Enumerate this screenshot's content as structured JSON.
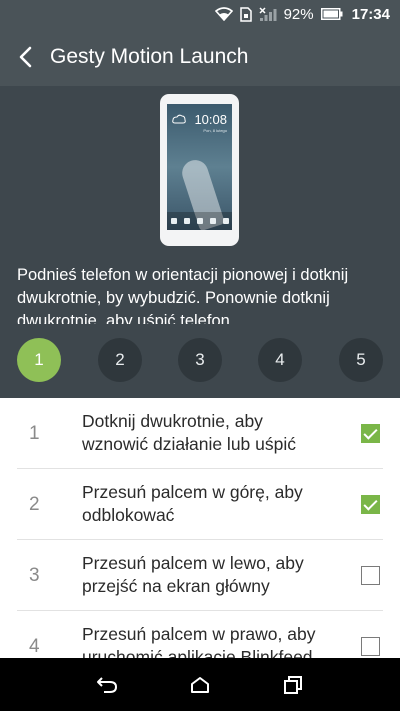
{
  "status": {
    "battery": "92%",
    "time": "17:34",
    "icons": [
      "wifi-icon",
      "sim-icon",
      "no-signal-icon",
      "battery-icon"
    ]
  },
  "app_bar": {
    "title": "Gesty Motion Launch",
    "back_icon": "back-arrow-icon"
  },
  "preview": {
    "time": "10:08",
    "date": "Pon, 8 lutego"
  },
  "description": "Podnieś telefon w orientacji pionowej i dotknij dwukrotnie, by wybudzić. Ponownie dotknij dwukrotnie, aby uśpić telefon.",
  "steps": {
    "items": [
      "1",
      "2",
      "3",
      "4",
      "5"
    ],
    "active": "1",
    "active_color": "#8fc057"
  },
  "gestures": [
    {
      "num": "1",
      "label": "Dotknij dwukrotnie, aby wznowić działanie lub uśpić",
      "checked": true
    },
    {
      "num": "2",
      "label": "Przesuń palcem w górę, aby odblokować",
      "checked": true
    },
    {
      "num": "3",
      "label": "Przesuń palcem w lewo, aby przejść na ekran główny",
      "checked": false
    },
    {
      "num": "4",
      "label": "Przesuń palcem w prawo, aby uruchomić aplikację Blinkfeed",
      "checked": false
    }
  ],
  "nav": [
    "back-nav-icon",
    "home-nav-icon",
    "recents-nav-icon"
  ],
  "colors": {
    "header": "#4a5358",
    "panel": "#3e474d",
    "check": "#7ab648"
  }
}
